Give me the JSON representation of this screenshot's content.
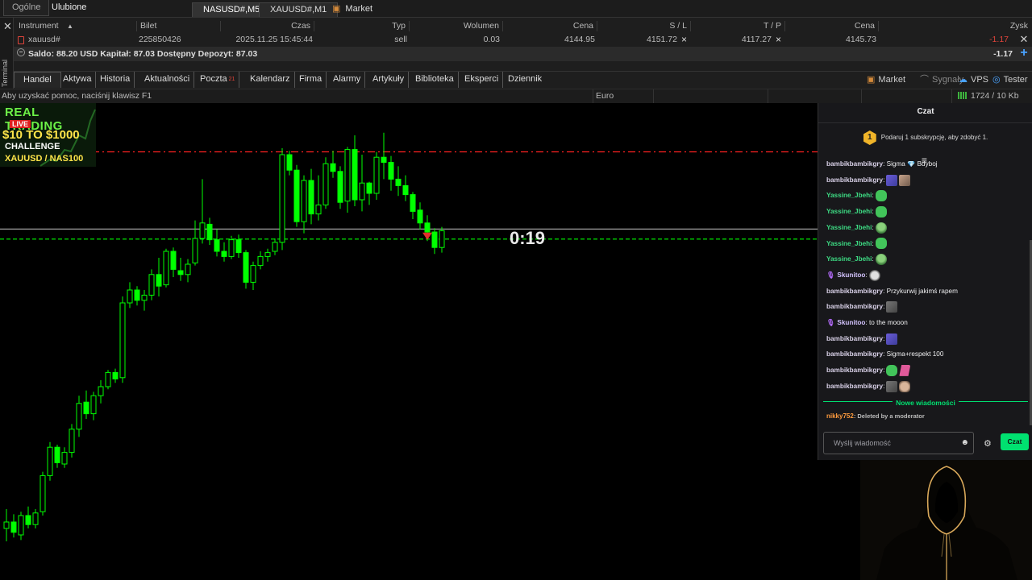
{
  "topbar": {
    "tabs": [
      "Ogólne",
      "Ulubione"
    ],
    "chart_tabs": [
      "NASUSD#,M5",
      "XAUUSD#,M1"
    ],
    "market_label": "Market"
  },
  "terminal": {
    "side_label": "Terminal",
    "columns": [
      "Instrument",
      "Bilet",
      "Czas",
      "Typ",
      "Wolumen",
      "Cena",
      "S / L",
      "T / P",
      "Cena",
      "Zysk"
    ],
    "position": {
      "instrument": "xauusd#",
      "ticket": "225850426",
      "time": "2025.11.25 15:45:44",
      "type": "sell",
      "volume": "0.03",
      "open_price": "4144.95",
      "sl": "4151.72",
      "tp": "4117.27",
      "price": "4145.73",
      "profit": "-1.17"
    },
    "summary": {
      "text": "Saldo: 88.20 USD  Kapitał: 87.03  Dostępny Depozyt: 87.03",
      "total": "-1.17"
    },
    "tabs": [
      {
        "label": "Handel"
      },
      {
        "label": "Aktywa"
      },
      {
        "label": "Historia"
      },
      {
        "label": "Aktualności"
      },
      {
        "label": "Poczta",
        "badge": "21"
      },
      {
        "label": "Kalendarz"
      },
      {
        "label": "Firma"
      },
      {
        "label": "Alarmy"
      },
      {
        "label": "Artykuły"
      },
      {
        "label": "Biblioteka"
      },
      {
        "label": "Eksperci"
      },
      {
        "label": "Dziennik"
      }
    ],
    "right_tabs": [
      "Market",
      "Sygnały",
      "VPS",
      "Tester"
    ]
  },
  "statusbar": {
    "help": "Aby uzyskać pomoc, naciśnij klawisz F1",
    "profile": "Euro",
    "network": "1724 / 10 Kb"
  },
  "chart": {
    "countdown": "0:19",
    "colors": {
      "bull": "#00ff00",
      "sl_line": "#ff2020",
      "bid_line": "#00ff00"
    }
  },
  "chart_data": {
    "type": "candlestick",
    "symbol": "XAUUSD#",
    "timeframe": "M1",
    "ohlc": [
      [
        4122.5,
        4124.0,
        4121.5,
        4123.0
      ],
      [
        4123.0,
        4123.6,
        4121.8,
        4122.2
      ],
      [
        4122.0,
        4123.8,
        4121.6,
        4123.5
      ],
      [
        4123.5,
        4124.2,
        4122.5,
        4122.8
      ],
      [
        4122.8,
        4124.0,
        4122.5,
        4123.7
      ],
      [
        4123.8,
        4126.9,
        4123.5,
        4126.6
      ],
      [
        4126.6,
        4129.2,
        4126.2,
        4128.8
      ],
      [
        4128.8,
        4129.0,
        4127.2,
        4127.6
      ],
      [
        4127.5,
        4128.8,
        4127.2,
        4128.4
      ],
      [
        4128.4,
        4130.6,
        4128.0,
        4130.2
      ],
      [
        4130.2,
        4132.8,
        4129.6,
        4132.2
      ],
      [
        4132.3,
        4133.2,
        4131.0,
        4131.4
      ],
      [
        4131.4,
        4133.1,
        4130.9,
        4132.8
      ],
      [
        4132.8,
        4134.0,
        4132.2,
        4133.5
      ],
      [
        4133.5,
        4134.8,
        4133.3,
        4134.6
      ],
      [
        4134.6,
        4134.9,
        4133.8,
        4134.1
      ],
      [
        4134.2,
        4140.5,
        4133.8,
        4140.0
      ],
      [
        4140.0,
        4141.6,
        4139.6,
        4141.0
      ],
      [
        4141.0,
        4141.3,
        4139.8,
        4140.2
      ],
      [
        4140.2,
        4141.0,
        4139.4,
        4140.6
      ],
      [
        4140.6,
        4142.6,
        4140.2,
        4142.2
      ],
      [
        4142.2,
        4143.5,
        4140.5,
        4141.3
      ],
      [
        4141.4,
        4144.2,
        4141.2,
        4144.0
      ],
      [
        4144.0,
        4144.3,
        4142.0,
        4142.6
      ],
      [
        4142.5,
        4143.5,
        4141.7,
        4142.2
      ],
      [
        4142.2,
        4143.4,
        4141.6,
        4143.0
      ],
      [
        4143.1,
        4146.4,
        4142.9,
        4145.0
      ],
      [
        4145.0,
        4149.6,
        4144.6,
        4146.2
      ],
      [
        4146.1,
        4146.6,
        4144.5,
        4144.9
      ],
      [
        4144.9,
        4145.7,
        4143.6,
        4144.0
      ],
      [
        4144.0,
        4144.7,
        4143.2,
        4143.6
      ],
      [
        4143.6,
        4145.2,
        4143.4,
        4144.9
      ],
      [
        4144.9,
        4145.3,
        4143.5,
        4143.9
      ],
      [
        4143.9,
        4144.1,
        4141.1,
        4141.6
      ],
      [
        4141.6,
        4143.2,
        4141.0,
        4142.9
      ],
      [
        4142.9,
        4144.0,
        4142.6,
        4143.6
      ],
      [
        4143.6,
        4144.2,
        4143.2,
        4143.9
      ],
      [
        4144.0,
        4145.0,
        4143.7,
        4144.7
      ],
      [
        4144.7,
        4152.0,
        4144.1,
        4151.5
      ],
      [
        4151.5,
        4151.8,
        4149.9,
        4150.3
      ],
      [
        4150.3,
        4150.7,
        4145.9,
        4146.3
      ],
      [
        4146.3,
        4149.9,
        4145.4,
        4149.5
      ],
      [
        4149.5,
        4150.4,
        4146.1,
        4146.9
      ],
      [
        4146.9,
        4149.9,
        4146.4,
        4147.6
      ],
      [
        4147.6,
        4151.3,
        4147.3,
        4150.8
      ],
      [
        4150.8,
        4151.8,
        4149.7,
        4150.2
      ],
      [
        4150.2,
        4150.6,
        4147.3,
        4147.8
      ],
      [
        4147.9,
        4152.1,
        4147.0,
        4151.9
      ],
      [
        4151.9,
        4153.0,
        4147.5,
        4148.0
      ],
      [
        4148.0,
        4151.5,
        4147.1,
        4149.3
      ],
      [
        4149.3,
        4149.4,
        4147.6,
        4148.5
      ],
      [
        4148.5,
        4151.7,
        4148.0,
        4151.3
      ],
      [
        4151.3,
        4153.2,
        4149.6,
        4150.9
      ],
      [
        4150.9,
        4151.4,
        4148.7,
        4149.6
      ],
      [
        4149.6,
        4150.6,
        4148.3,
        4149.1
      ],
      [
        4149.1,
        4149.9,
        4147.9,
        4148.4
      ],
      [
        4148.4,
        4148.6,
        4146.5,
        4147.1
      ],
      [
        4147.2,
        4147.8,
        4145.7,
        4146.2
      ],
      [
        4146.2,
        4146.8,
        4144.8,
        4145.5
      ],
      [
        4145.5,
        4145.8,
        4143.8,
        4144.3
      ],
      [
        4144.3,
        4145.9,
        4143.9,
        4145.6
      ]
    ],
    "horizontal_lines": [
      {
        "label": "S / L",
        "price": 4151.72,
        "style": "dash-dot",
        "color": "#ff2020"
      },
      {
        "label": "bid",
        "price": 4145.73,
        "style": "solid",
        "color": "#b0b0b0"
      },
      {
        "label": "open",
        "price": 4144.95,
        "style": "dashed",
        "color": "#00ff00"
      }
    ],
    "price_range": [
      4118.5,
      4155.5
    ],
    "grid": false
  },
  "overlay": {
    "line1": "REAL TRADING",
    "live": "LIVE",
    "line3": "$10 TO $1000",
    "line4": "CHALLENGE",
    "line5": "XAUUSD / NAS100"
  },
  "chat": {
    "title": "Czat",
    "promo_badge": "1",
    "promo": "Podaruj 1 subskrypcję, aby zdobyć 1.",
    "messages": [
      {
        "user": "bambikbambikgry",
        "text": ": Sigma 💎 Bdyboj",
        "color": "",
        "emotes": []
      },
      {
        "user": "bambikbambikgry",
        "text": ":",
        "color": "",
        "emotes": [
          "em-purple",
          "em-tan"
        ]
      },
      {
        "user": "Yassine_Jbehi",
        "text": ":",
        "color": "green",
        "emotes": [
          "em-green"
        ]
      },
      {
        "user": "Yassine_Jbehi",
        "text": ":",
        "color": "green",
        "emotes": [
          "em-green"
        ]
      },
      {
        "user": "Yassine_Jbehi",
        "text": ":",
        "color": "green",
        "emotes": [
          "em-pepe"
        ]
      },
      {
        "user": "Yassine_Jbehi",
        "text": ":",
        "color": "green",
        "emotes": [
          "em-green"
        ]
      },
      {
        "user": "Yassine_Jbehi",
        "text": ":",
        "color": "green",
        "emotes": [
          "em-pepe"
        ]
      },
      {
        "user": "Skunitoo",
        "text": ":",
        "color": "violet",
        "mic": true,
        "emotes": [
          "em-sheep"
        ]
      },
      {
        "user": "bambikbambikgry",
        "text": ": Przykurwij jakimś rapem",
        "color": "",
        "emotes": []
      },
      {
        "user": "bambikbambikgry",
        "text": ":",
        "color": "",
        "emotes": [
          "em-gray"
        ]
      },
      {
        "user": "Skunitoo",
        "text": ": to the mooon",
        "color": "violet",
        "mic": true,
        "emotes": []
      },
      {
        "user": "bambikbambikgry",
        "text": ":",
        "color": "",
        "emotes": [
          "em-purple"
        ]
      },
      {
        "user": "bambikbambikgry",
        "text": ": Sigma+respekt 100",
        "color": "",
        "emotes": []
      },
      {
        "user": "bambikbambikgry",
        "text": ":",
        "color": "",
        "emotes": [
          "em-green",
          "em-pink"
        ]
      },
      {
        "user": "bambikbambikgry",
        "text": ":",
        "color": "",
        "emotes": [
          "em-gray",
          "em-cat"
        ]
      }
    ],
    "new_messages": "Nowe wiadomości",
    "deleted": {
      "user": "nikky752",
      "text": ": Deleted by a moderator"
    },
    "input_placeholder": "Wyślij wiadomość",
    "send_label": "Czat"
  }
}
